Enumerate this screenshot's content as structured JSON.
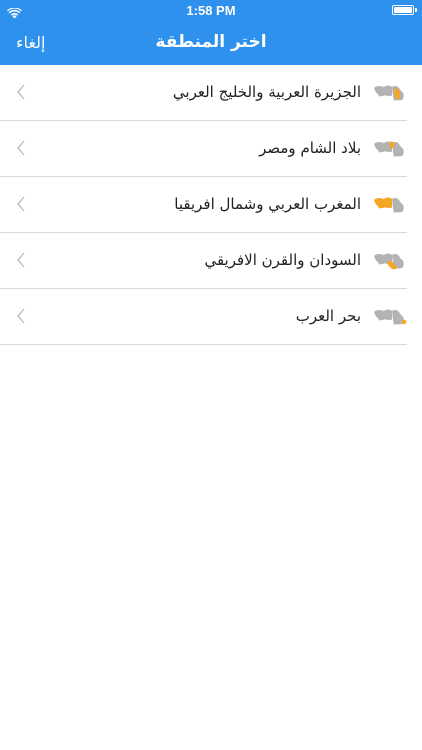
{
  "status_bar": {
    "time": "1:58 PM"
  },
  "nav": {
    "title": "اختر المنطقة",
    "cancel_label": "إلغاء"
  },
  "regions": [
    {
      "label": "الجزيرة العربية والخليج العربي",
      "icon": "arab-map-gulf-highlight-icon"
    },
    {
      "label": "بلاد الشام ومصر",
      "icon": "arab-map-levant-highlight-icon"
    },
    {
      "label": "المغرب العربي وشمال افريقيا",
      "icon": "arab-map-maghreb-highlight-icon"
    },
    {
      "label": "السودان والقرن الافريقي",
      "icon": "arab-map-horn-highlight-icon"
    },
    {
      "label": "بحر العرب",
      "icon": "arab-map-arabian-sea-highlight-icon"
    }
  ],
  "colors": {
    "header_bg": "#2f91ee",
    "highlight": "#f5a623",
    "map_gray": "#b3b3b3"
  }
}
